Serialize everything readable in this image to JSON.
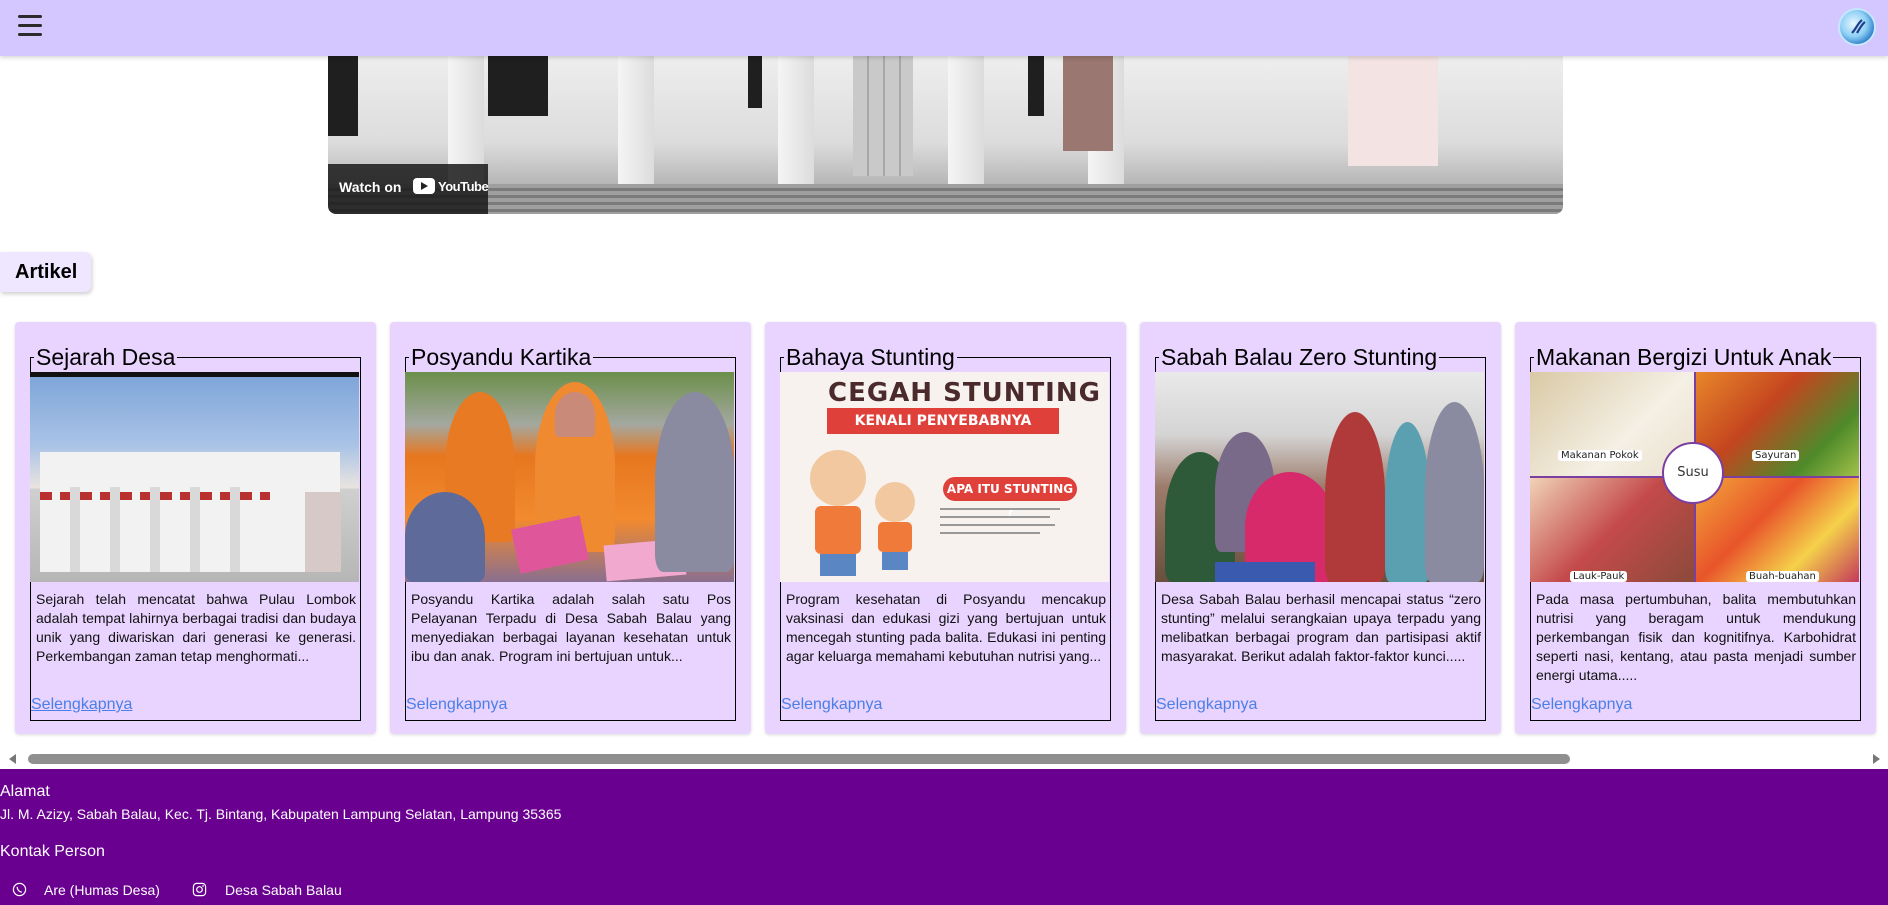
{
  "header": {
    "menu_icon": "hamburger-menu-icon",
    "logo_icon": "village-logo-icon"
  },
  "video": {
    "watch_on": "Watch on",
    "platform": "YouTube"
  },
  "section": {
    "title": "Artikel"
  },
  "articles": [
    {
      "title": "Sejarah Desa",
      "image": "village-hall-photo",
      "excerpt": "Sejarah telah mencatat bahwa Pulau Lombok adalah tempat lahirnya berbagai tradisi dan budaya unik yang diwariskan dari generasi ke generasi. Perkembangan zaman tetap menghormati...",
      "link": "Selengkapnya"
    },
    {
      "title": "Posyandu Kartika",
      "image": "posyandu-volunteers-photo",
      "excerpt": "Posyandu Kartika adalah salah satu Pos Pelayanan Terpadu di Desa Sabah Balau yang menyediakan berbagai layanan kesehatan untuk ibu dan anak. Program ini bertujuan untuk...",
      "link": "Selengkapnya"
    },
    {
      "title": "Bahaya Stunting",
      "image": "cegah-stunting-poster",
      "image_text": {
        "headline": "CEGAH STUNTING",
        "banner": "KENALI PENYEBABNYA",
        "pill": "APA ITU STUNTING ?"
      },
      "excerpt": "Program kesehatan di Posyandu mencakup vaksinasi dan edukasi gizi yang bertujuan untuk mencegah stunting pada balita. Edukasi ini penting agar keluarga memahami kebutuhan nutrisi yang...",
      "link": "Selengkapnya"
    },
    {
      "title": "Sabah Balau Zero Stunting",
      "image": "community-meeting-photo",
      "excerpt": "Desa Sabah Balau berhasil mencapai status “zero stunting” melalui serangkaian upaya terpadu yang melibatkan berbagai program dan partisipasi aktif masyarakat. Berikut adalah faktor-faktor kunci.....",
      "link": "Selengkapnya"
    },
    {
      "title": "Makanan Bergizi Untuk Anak",
      "image": "nutrition-food-chart",
      "image_text": {
        "center": "Susu",
        "q1": "Makanan Pokok",
        "q2": "Sayuran",
        "q3": "Lauk-Pauk",
        "q4": "Buah-buahan"
      },
      "excerpt": "Pada masa pertumbuhan, balita membutuhkan nutrisi yang beragam untuk mendukung perkembangan fisik dan kognitifnya. Karbohidrat seperti nasi, kentang, atau pasta menjadi sumber energi utama.....",
      "link": "Selengkapnya"
    }
  ],
  "footer": {
    "address_heading": "Alamat",
    "address": "Jl. M. Azizy, Sabah Balau, Kec. Tj. Bintang, Kabupaten Lampung Selatan, Lampung 35365",
    "contact_heading": "Kontak Person",
    "phone_contact": "Are (Humas Desa)",
    "instagram_contact": "Desa Sabah Balau"
  },
  "colors": {
    "header_bg": "#d4c6ff",
    "card_bg": "#e9d3ff",
    "link": "#4a7fe8",
    "footer_bg": "#6a0090"
  }
}
